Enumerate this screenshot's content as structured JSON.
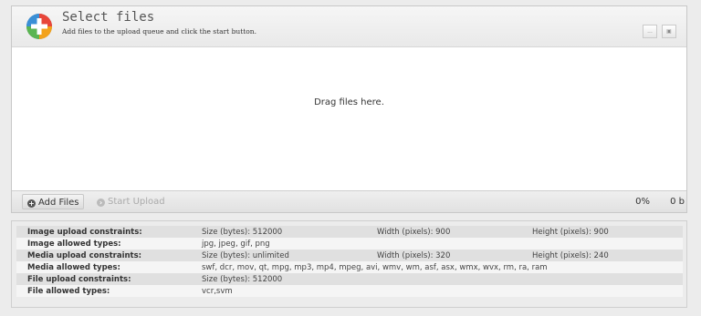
{
  "header": {
    "title": "Select files",
    "subtitle": "Add files to the upload queue and click the start button.",
    "btn_more": "...",
    "btn_view": "▣"
  },
  "dropzone": {
    "text": "Drag files here."
  },
  "footer": {
    "add_label": "Add Files",
    "start_label": "Start Upload",
    "percent": "0%",
    "bytes": "0 b"
  },
  "constraints": [
    {
      "label": "Image upload constraints:",
      "c1": "Size (bytes):  512000",
      "c2": "Width (pixels):  900",
      "c3": "Height (pixels):  900"
    },
    {
      "label": "Image allowed types:",
      "c1": "jpg, jpeg, gif, png",
      "c2": "",
      "c3": ""
    },
    {
      "label": "Media upload constraints:",
      "c1": "Size (bytes):  unlimited",
      "c2": "Width (pixels):  320",
      "c3": "Height (pixels):  240"
    },
    {
      "label": "Media allowed types:",
      "c1": "swf, dcr, mov, qt, mpg, mp3, mp4, mpeg, avi, wmv, wm, asf, asx, wmx, wvx, rm, ra, ram",
      "c2": "",
      "c3": ""
    },
    {
      "label": "File upload constraints:",
      "c1": "Size (bytes):  512000",
      "c2": "",
      "c3": ""
    },
    {
      "label": "File allowed types:",
      "c1": "vcr,svm",
      "c2": "",
      "c3": ""
    }
  ]
}
